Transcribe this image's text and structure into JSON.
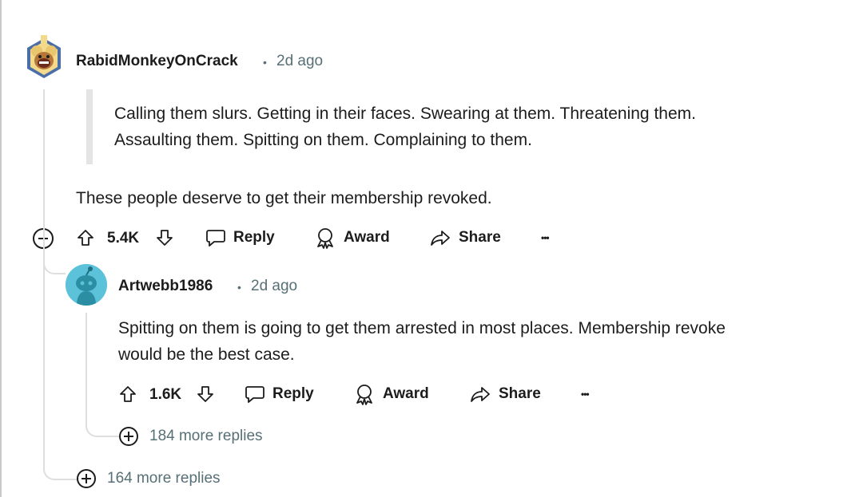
{
  "comment": {
    "username": "RabidMonkeyOnCrack",
    "separator": "•",
    "time_ago": "2d ago",
    "quote_line_1": "Calling them slurs. Getting in their faces. Swearing at them. Threatening them.",
    "quote_line_2": "Assaulting them. Spitting on them. Complaining to them.",
    "text": "These people deserve to get their membership revoked.",
    "score": "5.4K",
    "reply_label": "Reply",
    "award_label": "Award",
    "share_label": "Share",
    "more_label": "•••",
    "more_replies": "164 more replies"
  },
  "reply": {
    "username": "Artwebb1986",
    "separator": "•",
    "time_ago": "2d ago",
    "text_line_1": "Spitting on them is going to get them arrested in most places. Membership revoke",
    "text_line_2": "would be the best case.",
    "score": "1.6K",
    "reply_label": "Reply",
    "award_label": "Award",
    "share_label": "Share",
    "more_label": "•••",
    "more_replies": "184 more replies"
  },
  "colors": {
    "text": "#1c1c1c",
    "meta": "#576f76",
    "thread_line": "#dedede",
    "snoo_avatar_bg": "#5bc2d9"
  }
}
